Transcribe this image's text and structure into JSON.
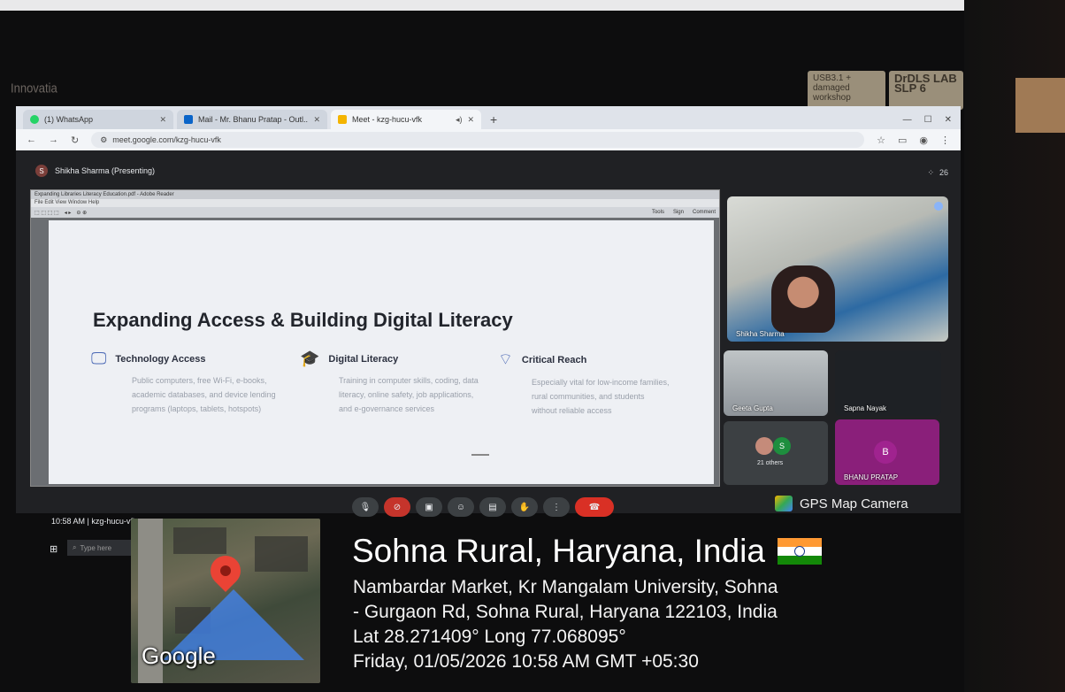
{
  "wall": {
    "label": "Innovatia",
    "sticky_notes": [
      "USB3.1 + damaged workshop",
      "DrDLS LAB SLP 6"
    ]
  },
  "browser": {
    "tabs": [
      {
        "label": "(1) WhatsApp",
        "icon": "whatsapp-icon",
        "color": "#25d366"
      },
      {
        "label": "Mail - Mr. Bhanu Pratap - Outl...",
        "icon": "outlook-icon",
        "color": "#0a64c8"
      },
      {
        "label": "Meet - kzg-hucu-vfk",
        "icon": "meet-icon",
        "color": "#f4b400",
        "active": true
      }
    ],
    "url": "meet.google.com/kzg-hucu-vfk"
  },
  "meet": {
    "presenter_initial": "S",
    "presenting_label": "Shikha Sharma (Presenting)",
    "participants_count": "26",
    "slide": {
      "title": "Expanding Access & Building Digital Literacy",
      "columns": [
        {
          "title": "Technology Access",
          "icon": "monitor-icon",
          "body": "Public computers, free Wi-Fi, e-books, academic databases, and device lending programs (laptops, tablets, hotspots)"
        },
        {
          "title": "Digital Literacy",
          "icon": "graduation-cap-icon",
          "body": "Training in computer skills, coding, data literacy, online safety, job applications, and e-governance services"
        },
        {
          "title": "Critical Reach",
          "icon": "wifi-icon",
          "body": "Especially vital for low-income families, rural communities, and students without reliable access"
        }
      ]
    },
    "tiles": {
      "main": "Shikha Sharma",
      "t2": "Geeta Gupta",
      "t3": "Sapna Nayak",
      "others": "21 others",
      "others_initial": "S",
      "t5": "BHANU PRATAP",
      "t5_initial": "B"
    }
  },
  "taskbar": {
    "time": "10:58 AM",
    "meeting": "kzg-hucu-vfk",
    "search_placeholder": "Type here"
  },
  "gps": {
    "brand": "GPS Map Camera",
    "map_logo": "Google",
    "place": "Sohna Rural, Haryana, India",
    "address_1": "Nambardar Market, Kr Mangalam University, Sohna",
    "address_2": "- Gurgaon Rd, Sohna Rural, Haryana 122103, India",
    "coords": "Lat 28.271409° Long 77.068095°",
    "datetime": "Friday, 01/05/2026 10:58 AM GMT +05:30",
    "flag_colors": [
      "#ff9933",
      "#ffffff",
      "#138808"
    ]
  }
}
